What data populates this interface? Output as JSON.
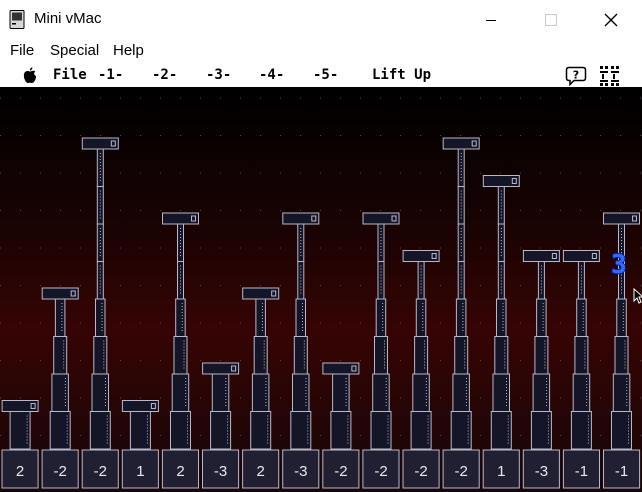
{
  "window": {
    "title": "Mini vMac",
    "icons": {
      "app": "mac-computer-icon",
      "minimize": "minimize-icon",
      "maximize": "maximize-icon",
      "close": "close-icon"
    }
  },
  "host_menu": {
    "file": "File",
    "special": "Special",
    "help": "Help"
  },
  "mac_menu": {
    "file": "File",
    "m1": "-1-",
    "m2": "-2-",
    "m3": "-3-",
    "m4": "-4-",
    "m5": "-5-",
    "lift_up": "Lift Up",
    "icons": {
      "apple": "apple-icon",
      "help": "help-balloon-icon",
      "app_menu": "application-menu-icon"
    }
  },
  "game": {
    "score": "3",
    "pillars": [
      {
        "label": "2",
        "segments": 1
      },
      {
        "label": "-2",
        "segments": 4
      },
      {
        "label": "-2",
        "segments": 8
      },
      {
        "label": "1",
        "segments": 1
      },
      {
        "label": "2",
        "segments": 6
      },
      {
        "label": "-3",
        "segments": 2
      },
      {
        "label": "2",
        "segments": 4
      },
      {
        "label": "-3",
        "segments": 6
      },
      {
        "label": "-2",
        "segments": 2
      },
      {
        "label": "-2",
        "segments": 6
      },
      {
        "label": "-2",
        "segments": 5
      },
      {
        "label": "-2",
        "segments": 8
      },
      {
        "label": "1",
        "segments": 7
      },
      {
        "label": "-3",
        "segments": 5
      },
      {
        "label": "-1",
        "segments": 5
      },
      {
        "label": "-1",
        "segments": 6
      }
    ]
  },
  "colors": {
    "score": "#2f6bff",
    "pillar_fill": "#151528",
    "pillar_stroke": "#b8b8c8"
  }
}
